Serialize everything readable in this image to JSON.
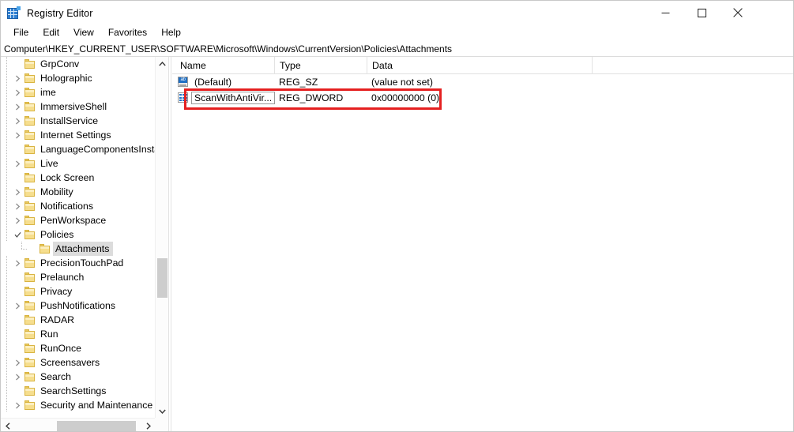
{
  "window": {
    "title": "Registry Editor",
    "icon": "registry-icon",
    "controls": {
      "minimize": "minimize-icon",
      "maximize": "maximize-icon",
      "close": "close-icon"
    }
  },
  "menubar": {
    "items": [
      {
        "label": "File"
      },
      {
        "label": "Edit"
      },
      {
        "label": "View"
      },
      {
        "label": "Favorites"
      },
      {
        "label": "Help"
      }
    ]
  },
  "address": {
    "path": "Computer\\HKEY_CURRENT_USER\\SOFTWARE\\Microsoft\\Windows\\CurrentVersion\\Policies\\Attachments"
  },
  "tree": {
    "items": [
      {
        "label": "GrpConv",
        "indent": 1,
        "expandable": false,
        "selected": false
      },
      {
        "label": "Holographic",
        "indent": 1,
        "expandable": true,
        "selected": false
      },
      {
        "label": "ime",
        "indent": 1,
        "expandable": true,
        "selected": false
      },
      {
        "label": "ImmersiveShell",
        "indent": 1,
        "expandable": true,
        "selected": false
      },
      {
        "label": "InstallService",
        "indent": 1,
        "expandable": true,
        "selected": false
      },
      {
        "label": "Internet Settings",
        "indent": 1,
        "expandable": true,
        "selected": false
      },
      {
        "label": "LanguageComponentsInstaller",
        "indent": 1,
        "expandable": false,
        "selected": false
      },
      {
        "label": "Live",
        "indent": 1,
        "expandable": true,
        "selected": false
      },
      {
        "label": "Lock Screen",
        "indent": 1,
        "expandable": false,
        "selected": false
      },
      {
        "label": "Mobility",
        "indent": 1,
        "expandable": true,
        "selected": false
      },
      {
        "label": "Notifications",
        "indent": 1,
        "expandable": true,
        "selected": false
      },
      {
        "label": "PenWorkspace",
        "indent": 1,
        "expandable": true,
        "selected": false
      },
      {
        "label": "Policies",
        "indent": 1,
        "expandable": true,
        "expanded": true,
        "selected": false
      },
      {
        "label": "Attachments",
        "indent": 2,
        "expandable": false,
        "selected": true
      },
      {
        "label": "PrecisionTouchPad",
        "indent": 1,
        "expandable": true,
        "selected": false
      },
      {
        "label": "Prelaunch",
        "indent": 1,
        "expandable": false,
        "selected": false
      },
      {
        "label": "Privacy",
        "indent": 1,
        "expandable": false,
        "selected": false
      },
      {
        "label": "PushNotifications",
        "indent": 1,
        "expandable": true,
        "selected": false
      },
      {
        "label": "RADAR",
        "indent": 1,
        "expandable": false,
        "selected": false
      },
      {
        "label": "Run",
        "indent": 1,
        "expandable": false,
        "selected": false
      },
      {
        "label": "RunOnce",
        "indent": 1,
        "expandable": false,
        "selected": false
      },
      {
        "label": "Screensavers",
        "indent": 1,
        "expandable": true,
        "selected": false
      },
      {
        "label": "Search",
        "indent": 1,
        "expandable": true,
        "selected": false
      },
      {
        "label": "SearchSettings",
        "indent": 1,
        "expandable": false,
        "selected": false
      },
      {
        "label": "Security and Maintenance",
        "indent": 1,
        "expandable": true,
        "selected": false
      }
    ]
  },
  "list": {
    "columns": [
      {
        "label": "Name"
      },
      {
        "label": "Type"
      },
      {
        "label": "Data"
      }
    ],
    "rows": [
      {
        "icon": "string-value-icon",
        "name": "(Default)",
        "type": "REG_SZ",
        "data": "(value not set)",
        "editing": false
      },
      {
        "icon": "dword-value-icon",
        "name": "ScanWithAntiVir...",
        "type": "REG_DWORD",
        "data": "0x00000000 (0)",
        "editing": true
      }
    ]
  },
  "annotation": {
    "color": "#e52020",
    "target": "scanwithantivirus-row"
  },
  "scrollbars": {
    "tree_vertical": "tree-vertical-scrollbar",
    "tree_horizontal": "tree-horizontal-scrollbar"
  }
}
